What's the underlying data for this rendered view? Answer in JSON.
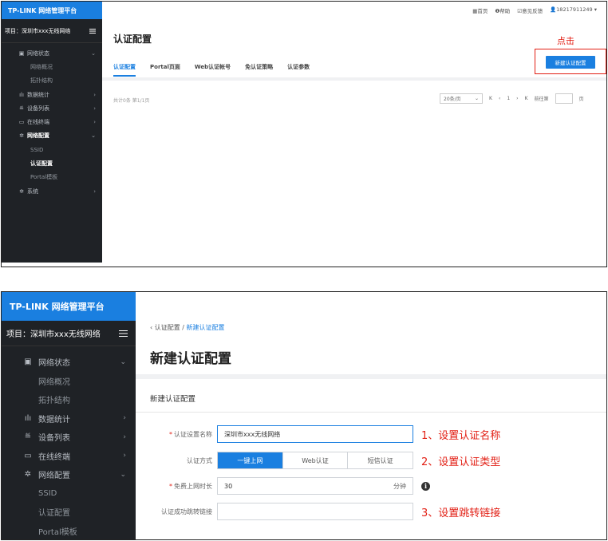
{
  "brand": "TP-LINK 网络管理平台",
  "project": "项目：深圳市xxx无线网络",
  "nav1": [
    {
      "icon": "▣",
      "label": "网络状态",
      "arrow": "⌄",
      "type": "group"
    },
    {
      "label": "网络概况",
      "type": "sub"
    },
    {
      "label": "拓扑结构",
      "type": "sub"
    },
    {
      "icon": "ılı",
      "label": "数据统计",
      "arrow": "›",
      "type": "group"
    },
    {
      "icon": "≝",
      "label": "设备列表",
      "arrow": "›",
      "type": "group"
    },
    {
      "icon": "▭",
      "label": "在线终端",
      "arrow": "›",
      "type": "group"
    },
    {
      "icon": "✲",
      "label": "网络配置",
      "arrow": "⌄",
      "type": "group-bold"
    },
    {
      "label": "SSID",
      "type": "sub"
    },
    {
      "label": "认证配置",
      "type": "sub-bold"
    },
    {
      "label": "Portal模板",
      "type": "sub"
    },
    {
      "icon": "✲",
      "label": "系统",
      "arrow": "›",
      "type": "group"
    }
  ],
  "nav2": [
    {
      "icon": "▣",
      "label": "网络状态",
      "arrow": "⌄",
      "type": "group"
    },
    {
      "label": "网络概况",
      "type": "sub"
    },
    {
      "label": "拓扑结构",
      "type": "sub"
    },
    {
      "icon": "ılı",
      "label": "数据统计",
      "arrow": "›",
      "type": "group"
    },
    {
      "icon": "≝",
      "label": "设备列表",
      "arrow": "›",
      "type": "group"
    },
    {
      "icon": "▭",
      "label": "在线终端",
      "arrow": "›",
      "type": "group"
    },
    {
      "icon": "✲",
      "label": "网络配置",
      "arrow": "⌄",
      "type": "group"
    },
    {
      "label": "SSID",
      "type": "sub"
    },
    {
      "label": "认证配置",
      "type": "sub"
    },
    {
      "label": "Portal模板",
      "type": "sub"
    }
  ],
  "topbar": {
    "home": "▦首页",
    "help": "❶帮助",
    "feedback": "☑意见反馈",
    "user": "👤18217911249 ▾"
  },
  "shot1": {
    "title": "认证配置",
    "tabs": [
      "认证配置",
      "Portal页面",
      "Web认证帐号",
      "免认证策略",
      "认证参数"
    ],
    "click_hint": "点击",
    "new_button": "新建认证配置",
    "total": "共计0条  第1/1页",
    "page_size": "20条/页",
    "page_size_caret": "⌄",
    "pager_first": "K",
    "pager_prev": "‹",
    "page_num": "1",
    "pager_next": "›",
    "pager_last": "K",
    "goto_label": "前往第",
    "goto_suffix": "页"
  },
  "shot2": {
    "crumb_back": "‹ 认证配置 / ",
    "crumb_current": "新建认证配置",
    "title": "新建认证配置",
    "section": "新建认证配置",
    "name_label": "认证设置名称",
    "name_value": "深圳市xxx无线网络",
    "auth_label": "认证方式",
    "auth_options": [
      "一键上网",
      "Web认证",
      "短信认证"
    ],
    "free_label": "免费上网时长",
    "free_value": "30",
    "free_unit": "分钟",
    "info_glyph": "i",
    "redirect_label": "认证成功跳转链接",
    "redirect_value": "",
    "req_mark": "*",
    "anno1": "1、设置认证名称",
    "anno2": "2、设置认证类型",
    "anno3": "3、设置跳转链接"
  },
  "colors": {
    "accent": "#1a7fe0",
    "highlight": "#e21f14",
    "sidebar": "#1f2226"
  }
}
